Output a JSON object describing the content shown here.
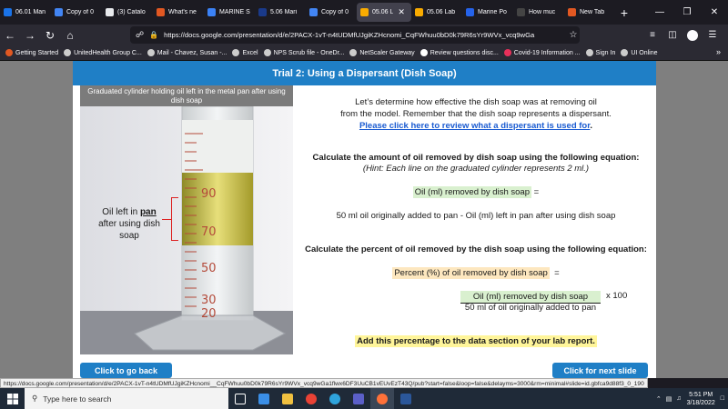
{
  "tabs": [
    {
      "label": "06.01 Man",
      "color": "#1a73e8"
    },
    {
      "label": "Copy of 0",
      "color": "#4285f4"
    },
    {
      "label": "(3) Catalo",
      "color": "#e8eaed"
    },
    {
      "label": "What's ne",
      "color": "#e25822"
    },
    {
      "label": "MARINE S",
      "color": "#3b82f6"
    },
    {
      "label": "5.06 Mari",
      "color": "#1a3a8a"
    },
    {
      "label": "Copy of 0",
      "color": "#4285f4"
    },
    {
      "label": "05.06 L",
      "color": "#f9ab00",
      "active": true
    },
    {
      "label": "05.06 Lab",
      "color": "#f9ab00"
    },
    {
      "label": "Marine Po",
      "color": "#2563eb"
    },
    {
      "label": "How muc",
      "color": "#444444"
    },
    {
      "label": "New Tab",
      "color": "#e25822"
    }
  ],
  "url": "https://docs.google.com/presentation/d/e/2PACX-1vT-n4tUDMfUJgiKZHcnomi_CqFWhuu0bD0k79R6sYr9WVx_vcq9wGa",
  "bookmarks": [
    {
      "label": "Getting Started",
      "color": "#e25822"
    },
    {
      "label": "UnitedHealth Group C...",
      "color": "#cccccc"
    },
    {
      "label": "Mail - Chavez, Susan -...",
      "color": "#cccccc"
    },
    {
      "label": "Excel",
      "color": "#cccccc"
    },
    {
      "label": "NPS Scrub file - OneDr...",
      "color": "#cccccc"
    },
    {
      "label": "NetScaler Gateway",
      "color": "#cccccc"
    },
    {
      "label": "Review questions disc...",
      "color": "#ffffff"
    },
    {
      "label": "Covid-19 Information ...",
      "color": "#e8305a"
    },
    {
      "label": "Sign In",
      "color": "#cccccc"
    },
    {
      "label": "UI Online",
      "color": "#cccccc"
    }
  ],
  "slide": {
    "title": "Trial 2: Using a Dispersant (Dish Soap)",
    "caption": "Graduated cylinder holding oil left in the metal pan after using dish soap",
    "photo_label_pre": "Oil left in",
    "photo_label_pan": "pan",
    "photo_label_post": "after using dish soap",
    "cylinder_marks": [
      "90",
      "70",
      "50",
      "30",
      "20"
    ],
    "intro_line1": "Let’s determine how effective the dish soap was at removing oil",
    "intro_line2": "from the model. Remember that the dish soap represents a dispersant.",
    "review_link": "Please click here to review what a dispersant is used for",
    "review_link_end": ".",
    "calc_amount_heading": "Calculate the amount of oil removed by dish soap using the following equation:",
    "calc_amount_hint": "(Hint: Each line on the graduated cylinder represents 2 ml.)",
    "eq1_label": "Oil (ml) removed by dish soap",
    "eq1_equals": "=",
    "eq1_formula": "50 ml oil originally added to pan - Oil (ml) left in pan after using dish soap",
    "calc_percent_heading": "Calculate the percent of oil removed by the dish soap using the following equation:",
    "eq2_label": "Percent (%) of oil removed by dish soap",
    "eq2_equals": "=",
    "eq2_numerator": "Oil (ml) removed by dish soap",
    "eq2_times": "x   100",
    "eq2_denominator": "50 ml of oil originally added to pan",
    "footer_note": "Add this percentage to the data section of your lab report.",
    "back_button": "Click to go back",
    "next_button": "Click for next slide"
  },
  "status_url": "https://docs.google.com/presentation/d/e/2PACX-1vT-n4tUDMfUJgiKZHcnomi__CqFWhuu0bD0k79R6sYr9WVx_vcq9wGa1flwx6DF3UuCB1vEUvEzT43Q/pub?start=false&loop=false&delayms=3000&rm=minimal#slide=id.gbfca9d88f3_0_190",
  "taskbar": {
    "search_placeholder": "Type here to search",
    "time": "5:51 PM",
    "date": "3/18/2022"
  }
}
